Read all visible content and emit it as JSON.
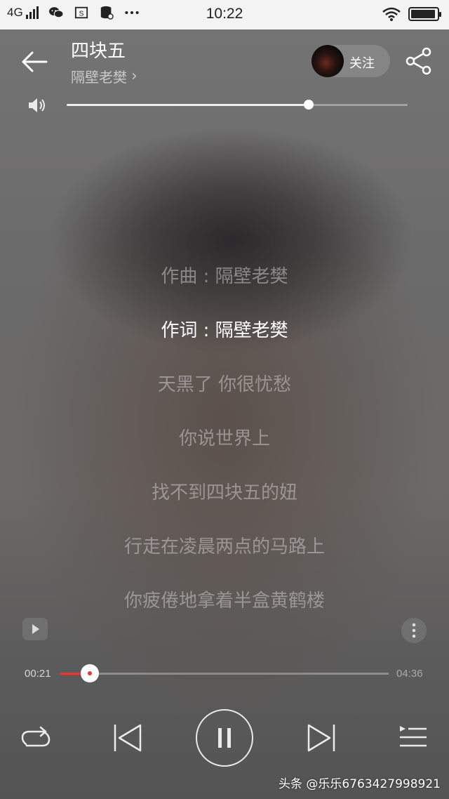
{
  "status_bar": {
    "network": "4G",
    "time": "10:22",
    "icons": [
      "signal-icon",
      "wechat-icon",
      "screenshot-icon",
      "storage-icon",
      "more-dots-icon",
      "wifi-icon",
      "battery-icon"
    ],
    "battery_level": 0.95
  },
  "header": {
    "back_icon": "back-arrow-icon",
    "title": "四块五",
    "artist": "隔壁老樊",
    "artist_chevron": "›",
    "follow_label": "关注",
    "share_icon": "share-icon"
  },
  "volume": {
    "icon": "speaker-icon",
    "level": 0.71
  },
  "lyrics": [
    {
      "text": "作曲 : 隔壁老樊",
      "active": false
    },
    {
      "text": "作词 : 隔壁老樊",
      "active": true
    },
    {
      "text": "天黑了 你很忧愁",
      "active": false
    },
    {
      "text": "你说世界上",
      "active": false
    },
    {
      "text": "找不到四块五的妞",
      "active": false
    },
    {
      "text": "行走在凌晨两点的马路上",
      "active": false
    },
    {
      "text": "你疲倦地拿着半盒黄鹤楼",
      "active": false
    }
  ],
  "side_actions": {
    "mv_icon": "play-video-icon",
    "more_icon": "more-vertical-icon"
  },
  "progress": {
    "elapsed": "00:21",
    "total": "04:36",
    "fraction": 0.09
  },
  "controls": {
    "repeat_icon": "repeat-icon",
    "prev_icon": "previous-icon",
    "pause_icon": "pause-icon",
    "next_icon": "next-icon",
    "playlist_icon": "playlist-icon"
  },
  "watermark": "头条 @乐乐6763427998921",
  "colors": {
    "accent": "#e23b33",
    "status_bar_bg": "#f3f3f3"
  }
}
